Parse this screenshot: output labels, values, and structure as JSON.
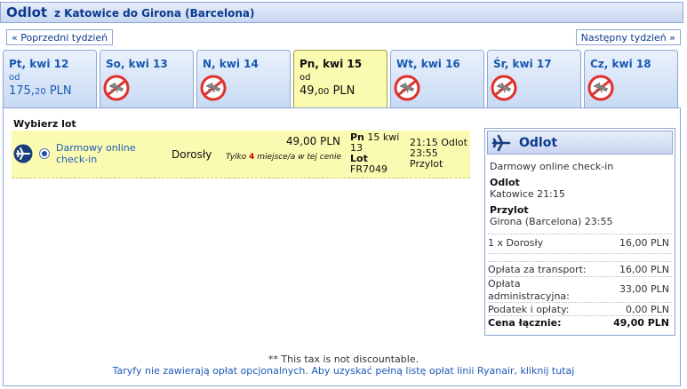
{
  "header": {
    "title": "Odlot",
    "route": "z Katowice do Girona (Barcelona)"
  },
  "nav": {
    "prev_week": "« Poprzedni tydzień",
    "next_week": "Następny tydzień »"
  },
  "tabs": [
    {
      "day": "Pt, kwi 12",
      "from": "od",
      "price_main": "175,",
      "price_dec": "20",
      "currency": " PLN",
      "available": true,
      "selected": false
    },
    {
      "day": "So, kwi 13",
      "available": false,
      "selected": false
    },
    {
      "day": "N, kwi 14",
      "available": false,
      "selected": false
    },
    {
      "day": "Pn, kwi 15",
      "from": "od",
      "price_main": "49,",
      "price_dec": "00",
      "currency": " PLN",
      "available": true,
      "selected": true
    },
    {
      "day": "Wt, kwi 16",
      "available": false,
      "selected": false
    },
    {
      "day": "Śr, kwi 17",
      "available": false,
      "selected": false
    },
    {
      "day": "Cz, kwi 18",
      "available": false,
      "selected": false
    }
  ],
  "flights": {
    "heading": "Wybierz lot",
    "row": {
      "checkin": "Darmowy online check-in",
      "passenger": "Dorosły",
      "price": "49,00 PLN",
      "only_pre": "Tylko ",
      "only_num": "4",
      "only_post": " miejsce/a w tej cenie",
      "dep_day": "Pn",
      "dep_date": " 15 kwi 13",
      "flight_label": "Lot",
      "flight_no": "FR7049",
      "dep_time_label": "21:15 Odlot",
      "arr_time": "23:55",
      "arr_label": "Przylot"
    }
  },
  "summary": {
    "title": "Odlot",
    "checkin": "Darmowy online check-in",
    "dep_label": "Odlot",
    "dep_value": "Katowice 21:15",
    "arr_label": "Przylot",
    "arr_value": "Girona (Barcelona) 23:55",
    "pax_label": "1 x Dorosły",
    "pax_value": "16,00 PLN",
    "transport_label": "Opłata za transport:",
    "transport_value": "16,00 PLN",
    "admin_label": "Opłata administracyjna:",
    "admin_value": "33,00 PLN",
    "tax_label": "Podatek i opłaty:",
    "tax_value": "0,00 PLN",
    "total_label": "Cena łącznie:",
    "total_value": "49,00 PLN"
  },
  "footer": {
    "tax_note": "** This tax is not discountable.",
    "fees_link": "Taryfy nie zawierają opłat opcjonalnych. Aby uzyskać pełną listę opłat linii Ryanair, kliknij tutaj"
  },
  "colors": {
    "brand": "#0b3a8e",
    "link": "#1c5ab8",
    "selected_bg": "#fafab0",
    "no_flight": "#e0302a"
  }
}
